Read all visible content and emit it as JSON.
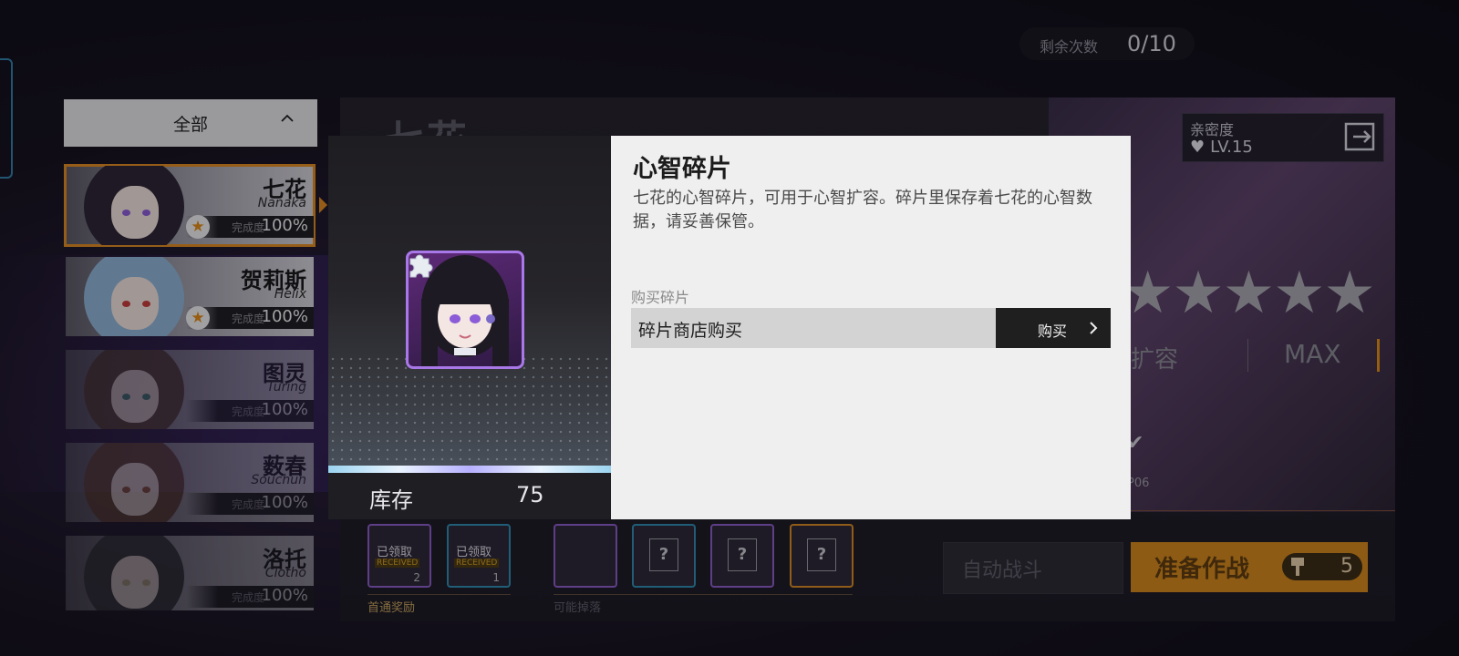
{
  "counter": {
    "label": "剩余次数",
    "value": "0/10"
  },
  "filter": {
    "label": "全部"
  },
  "characters": [
    {
      "name": "七花",
      "en": "Nanaka",
      "progress_label": "完成度",
      "progress": "100%",
      "starred": true,
      "selected": true,
      "hair": "#2a2330",
      "eye": "#8b5bd8"
    },
    {
      "name": "贺莉斯",
      "en": "Helix",
      "progress_label": "完成度",
      "progress": "100%",
      "starred": true,
      "selected": false,
      "hair": "#8fb6d8",
      "eye": "#c83a3a"
    },
    {
      "name": "图灵",
      "en": "Turing",
      "progress_label": "完成度",
      "progress": "100%",
      "starred": false,
      "selected": false,
      "hair": "#5c4638",
      "eye": "#4a8a80"
    },
    {
      "name": "薮春",
      "en": "Souchun",
      "progress_label": "完成度",
      "progress": "100%",
      "starred": false,
      "selected": false,
      "hair": "#6a4a3a",
      "eye": "#9a5a3a"
    },
    {
      "name": "洛托",
      "en": "Clotho",
      "progress_label": "完成度",
      "progress": "100%",
      "starred": false,
      "selected": false,
      "hair": "#3a3a3e",
      "eye": "#c8b890"
    }
  ],
  "stage": {
    "title": "七花",
    "intimacy_label": "亲密度",
    "intimacy_level": "LV.15",
    "stars": "★★★★★",
    "expand_label": "扩容",
    "expand_value": "MAX",
    "map_code": "P06",
    "first_clear_caption": "首通奖励",
    "possible_drop_caption": "可能掉落",
    "received_label": "已领取",
    "received_sub": "RECEIVED",
    "slot_counts": [
      "2",
      "1"
    ],
    "mystery_glyph": "?",
    "auto_battle": "自动战斗",
    "start_battle": "准备作战",
    "stamina_cost": "5"
  },
  "modal": {
    "title": "心智碎片",
    "description": "七花的心智碎片，可用于心智扩容。碎片里保存着七花的心智数据，请妥善保管。",
    "buy_section_label": "购买碎片",
    "buy_row_label": "碎片商店购买",
    "buy_button": "购买",
    "stock_label": "库存",
    "stock_value": "75"
  },
  "colors": {
    "accent_orange": "#e08a1e",
    "frame_purple": "#a978e8",
    "frame_blue": "#2d8cb0"
  },
  "icons": [
    "chevron-up-icon",
    "star-icon",
    "heart-icon",
    "exit-icon",
    "check-icon",
    "puzzle-piece-icon",
    "chevron-right-icon",
    "stamina-icon"
  ]
}
